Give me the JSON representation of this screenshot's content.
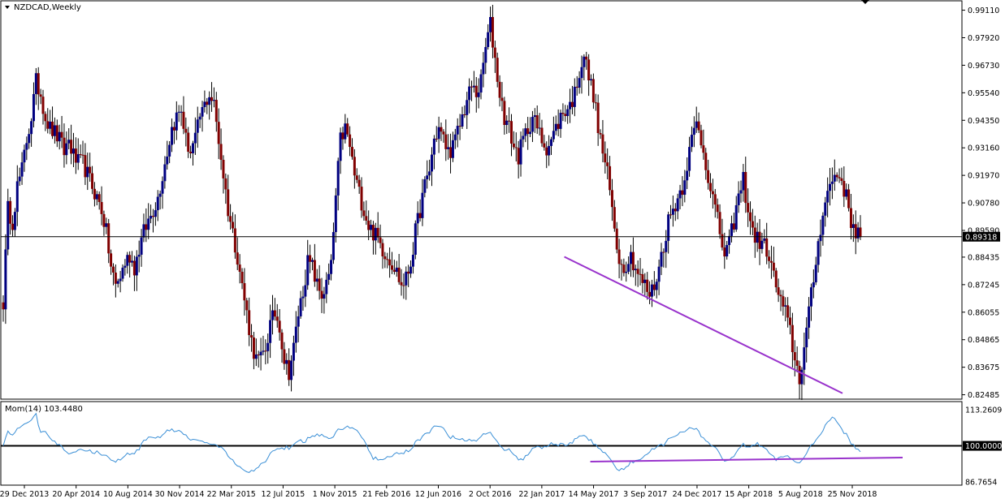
{
  "chart_data": [
    {
      "type": "candlestick",
      "symbol_label": "NZDCAD,Weekly",
      "x_tick_labels": [
        "29 Dec 2013",
        "20 Apr 2014",
        "10 Aug 2014",
        "30 Nov 2014",
        "22 Mar 2015",
        "12 Jul 2015",
        "1 Nov 2015",
        "21 Feb 2016",
        "12 Jun 2016",
        "2 Oct 2016",
        "22 Jan 2017",
        "14 May 2017",
        "3 Sep 2017",
        "24 Dec 2017",
        "15 Apr 2018",
        "5 Aug 2018",
        "25 Nov 2018"
      ],
      "y_tick_labels": [
        "0.99110",
        "0.97920",
        "0.96730",
        "0.95540",
        "0.94350",
        "0.93160",
        "0.91970",
        "0.90780",
        "0.89590",
        "0.88435",
        "0.87245",
        "0.86055",
        "0.84865",
        "0.83675",
        "0.82485"
      ],
      "ylim": [
        0.8233,
        0.9948
      ],
      "current_price_label": "0.89318",
      "current_price": 0.89318,
      "series_anchors": [
        0.865,
        0.905,
        0.9,
        0.915,
        0.922,
        0.935,
        0.945,
        0.96,
        0.955,
        0.945,
        0.94,
        0.938,
        0.935,
        0.93,
        0.935,
        0.928,
        0.925,
        0.925,
        0.92,
        0.915,
        0.91,
        0.905,
        0.895,
        0.88,
        0.872,
        0.876,
        0.882,
        0.885,
        0.88,
        0.888,
        0.895,
        0.9,
        0.905,
        0.91,
        0.92,
        0.93,
        0.94,
        0.945,
        0.948,
        0.935,
        0.93,
        0.935,
        0.945,
        0.95,
        0.955,
        0.95,
        0.935,
        0.92,
        0.905,
        0.895,
        0.885,
        0.872,
        0.86,
        0.848,
        0.84,
        0.84,
        0.845,
        0.855,
        0.86,
        0.855,
        0.84,
        0.835,
        0.845,
        0.86,
        0.87,
        0.882,
        0.88,
        0.872,
        0.868,
        0.872,
        0.88,
        0.91,
        0.935,
        0.94,
        0.932,
        0.92,
        0.912,
        0.905,
        0.898,
        0.895,
        0.892,
        0.888,
        0.885,
        0.882,
        0.878,
        0.872,
        0.875,
        0.882,
        0.895,
        0.905,
        0.915,
        0.922,
        0.935,
        0.94,
        0.935,
        0.93,
        0.932,
        0.938,
        0.945,
        0.952,
        0.958,
        0.955,
        0.96,
        0.975,
        0.985,
        0.97,
        0.955,
        0.945,
        0.94,
        0.932,
        0.928,
        0.935,
        0.94,
        0.945,
        0.94,
        0.935,
        0.932,
        0.935,
        0.94,
        0.945,
        0.948,
        0.95,
        0.955,
        0.965,
        0.972,
        0.962,
        0.955,
        0.94,
        0.93,
        0.92,
        0.905,
        0.89,
        0.88,
        0.882,
        0.885,
        0.88,
        0.875,
        0.872,
        0.868,
        0.872,
        0.88,
        0.89,
        0.9,
        0.905,
        0.91,
        0.915,
        0.925,
        0.935,
        0.942,
        0.935,
        0.925,
        0.915,
        0.905,
        0.895,
        0.885,
        0.89,
        0.9,
        0.91,
        0.918,
        0.905,
        0.895,
        0.892,
        0.89,
        0.888,
        0.88,
        0.872,
        0.865,
        0.86,
        0.852,
        0.84,
        0.832,
        0.845,
        0.86,
        0.875,
        0.89,
        0.905,
        0.912,
        0.918,
        0.92,
        0.918,
        0.91,
        0.9,
        0.896,
        0.893
      ],
      "trendline_price": {
        "points": [
          {
            "date": "14 May 2017",
            "value": 0.8845
          },
          {
            "date": "25 Nov 2018",
            "value": 0.8255
          }
        ]
      }
    },
    {
      "type": "line",
      "indicator_label": "Mom(14) 103.4480",
      "y_tick_labels": [
        "113.2609",
        "100.0000",
        "86.7654"
      ],
      "ylim": [
        86.7654,
        113.2609
      ],
      "reference_level": 100.0,
      "trendline_indicator": {
        "points": [
          {
            "date": "14 May 2017",
            "value": 94.2
          },
          {
            "date": "25 Nov 2018",
            "value": 95.7
          }
        ]
      }
    }
  ],
  "colors": {
    "bull": "#000080",
    "bear": "#800000",
    "momentum": "#3a8fd6",
    "trendline": "#9933cc",
    "grid_frame": "#000000",
    "background": "#ffffff"
  }
}
